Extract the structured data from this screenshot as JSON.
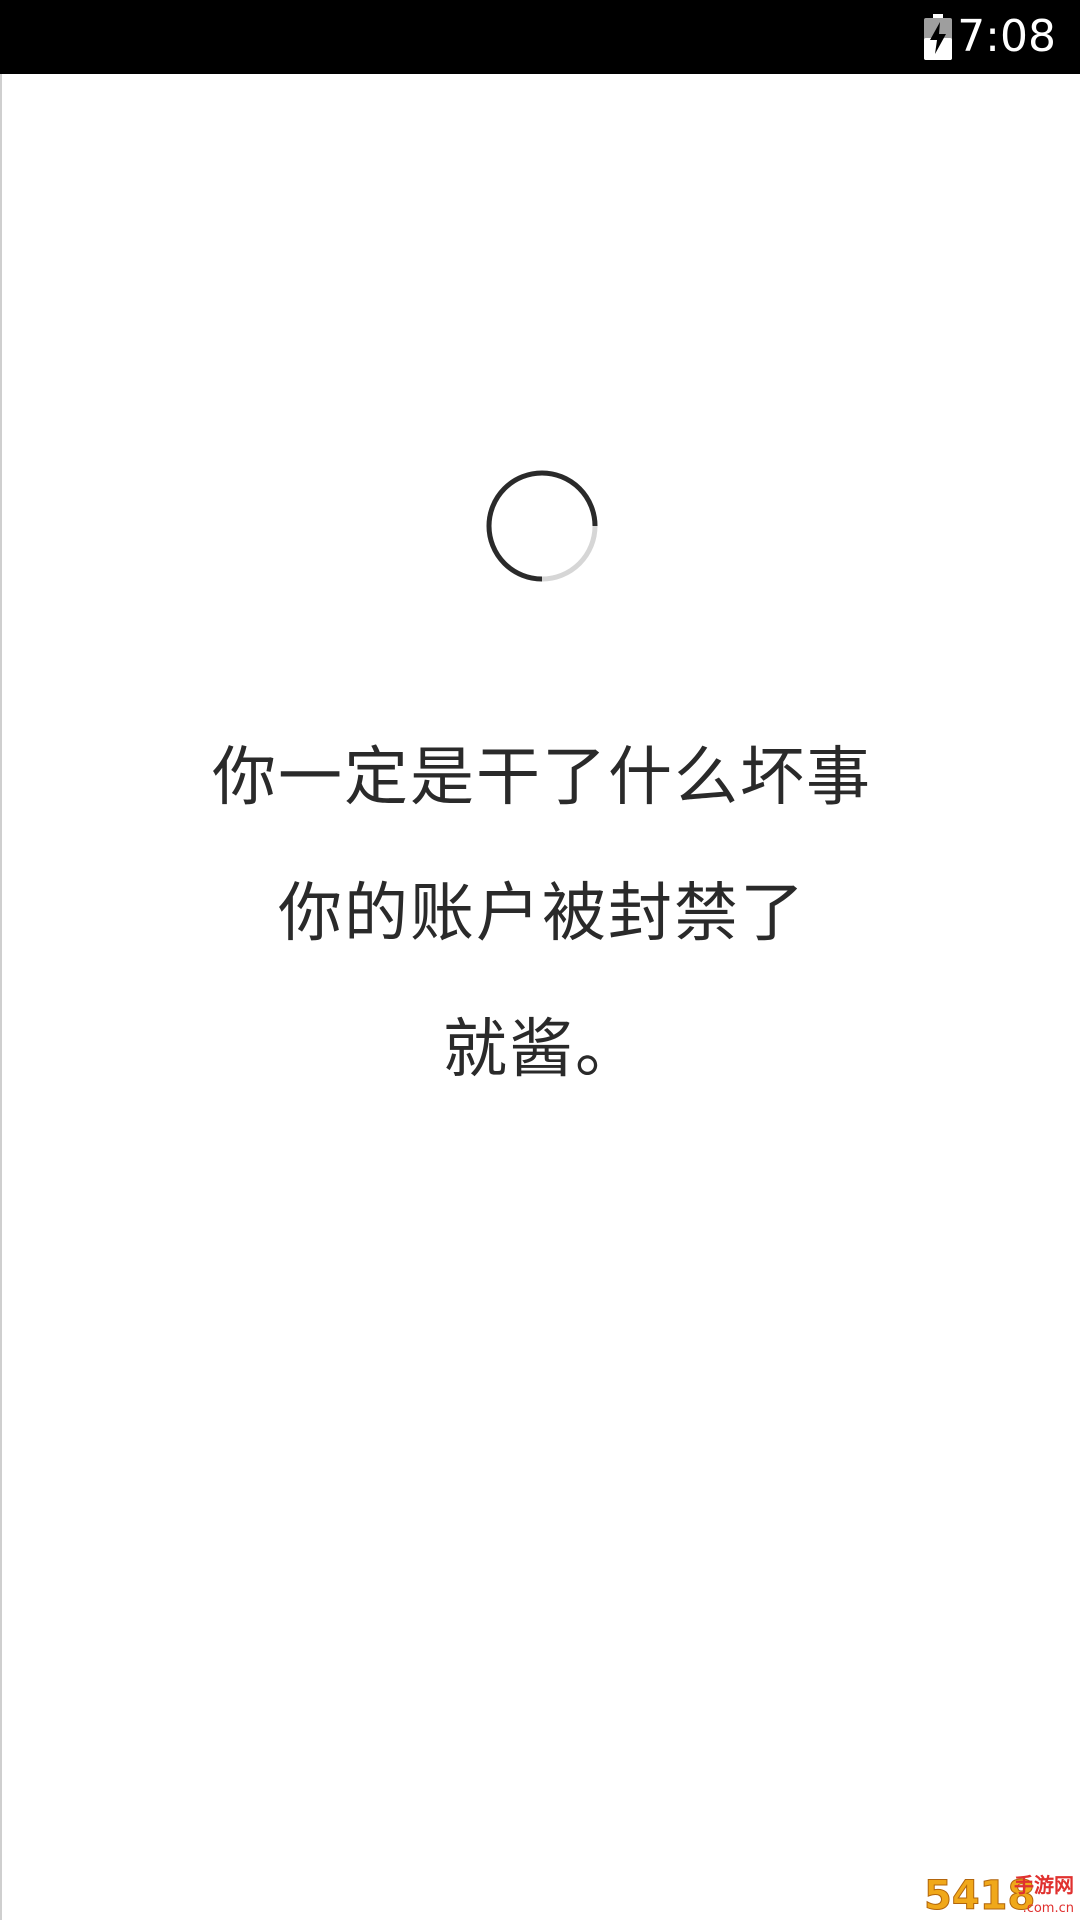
{
  "status_bar": {
    "time": "7:08",
    "battery_icon": "battery-charging-icon"
  },
  "loading": {
    "icon": "loading-spinner-icon"
  },
  "message": {
    "line1": "你一定是干了什么坏事",
    "line2": "你的账户被封禁了",
    "line3": "就酱。"
  },
  "watermark": {
    "number": "5418",
    "site": "手游网",
    "domain": ".com.cn"
  },
  "colors": {
    "status_bar_bg": "#000000",
    "page_bg": "#ffffff",
    "text": "#2a2a2a",
    "spinner_dark": "#2a2a2a",
    "spinner_light": "#d6d6d6"
  }
}
